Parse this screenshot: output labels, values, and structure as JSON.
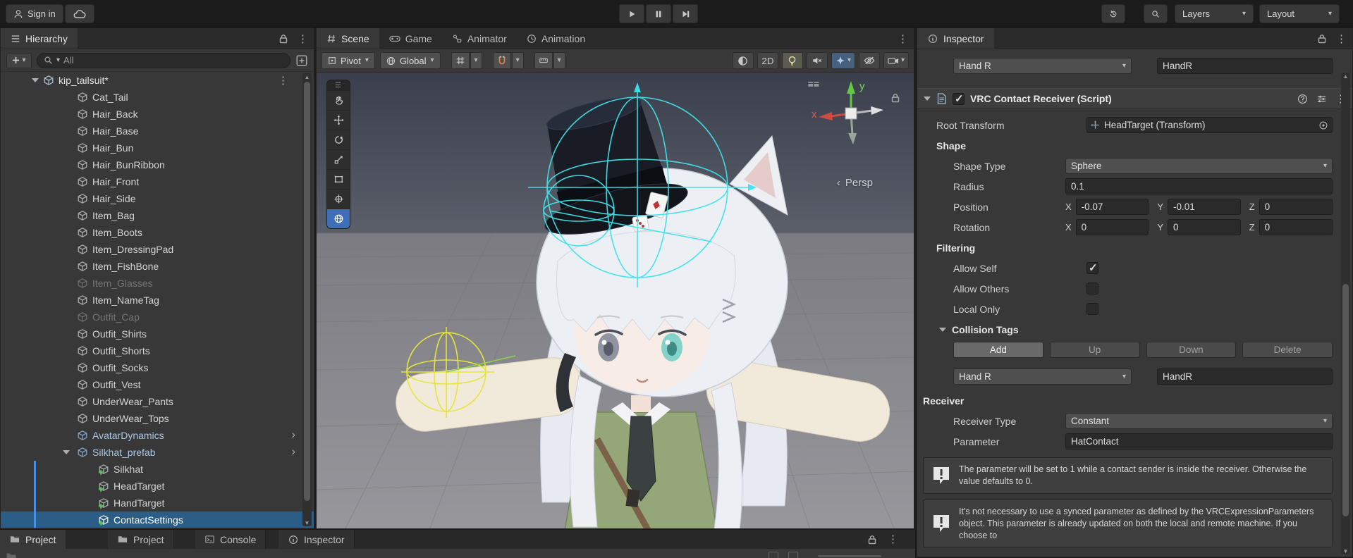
{
  "topbar": {
    "sign_in_label": "Sign in",
    "layers_label": "Layers",
    "layout_label": "Layout"
  },
  "hierarchy": {
    "tab_label": "Hierarchy",
    "search_placeholder": "All",
    "root_label": "kip_tailsuit*",
    "items": [
      {
        "label": "Cat_Tail",
        "state": "normal"
      },
      {
        "label": "Hair_Back",
        "state": "normal"
      },
      {
        "label": "Hair_Base",
        "state": "normal"
      },
      {
        "label": "Hair_Bun",
        "state": "normal"
      },
      {
        "label": "Hair_BunRibbon",
        "state": "normal"
      },
      {
        "label": "Hair_Front",
        "state": "normal"
      },
      {
        "label": "Hair_Side",
        "state": "normal"
      },
      {
        "label": "Item_Bag",
        "state": "normal"
      },
      {
        "label": "Item_Boots",
        "state": "normal"
      },
      {
        "label": "Item_DressingPad",
        "state": "normal"
      },
      {
        "label": "Item_FishBone",
        "state": "normal"
      },
      {
        "label": "Item_Glasses",
        "state": "disabled"
      },
      {
        "label": "Item_NameTag",
        "state": "normal"
      },
      {
        "label": "Outfit_Cap",
        "state": "disabled"
      },
      {
        "label": "Outfit_Shirts",
        "state": "normal"
      },
      {
        "label": "Outfit_Shorts",
        "state": "normal"
      },
      {
        "label": "Outfit_Socks",
        "state": "normal"
      },
      {
        "label": "Outfit_Vest",
        "state": "normal"
      },
      {
        "label": "UnderWear_Pants",
        "state": "normal"
      },
      {
        "label": "UnderWear_Tops",
        "state": "normal"
      },
      {
        "label": "AvatarDynamics",
        "state": "prefab"
      },
      {
        "label": "Silkhat_prefab",
        "state": "prefab-expanded"
      },
      {
        "label": "Silkhat",
        "state": "added-child"
      },
      {
        "label": "HeadTarget",
        "state": "added-child"
      },
      {
        "label": "HandTarget",
        "state": "added-child"
      },
      {
        "label": "ContactSettings",
        "state": "added-child-selected"
      }
    ]
  },
  "scene": {
    "tabs": [
      {
        "label": "Scene"
      },
      {
        "label": "Game"
      },
      {
        "label": "Animator"
      },
      {
        "label": "Animation"
      }
    ],
    "toolbar": {
      "pivot_label": "Pivot",
      "global_label": "Global",
      "mode_2d_label": "2D"
    },
    "viewport": {
      "persp_label": "Persp",
      "axis_x_label": "x",
      "axis_y_label": "y"
    }
  },
  "inspector": {
    "tab_label": "Inspector",
    "target_dropdown_value": "Hand R",
    "target_name_value": "HandR",
    "component_title": "VRC Contact Receiver (Script)",
    "axes": {
      "x": "X",
      "y": "Y",
      "z": "Z"
    },
    "root_transform": {
      "label": "Root Transform",
      "value": "HeadTarget (Transform)"
    },
    "shape": {
      "header": "Shape",
      "shape_type_label": "Shape Type",
      "shape_type_value": "Sphere",
      "radius_label": "Radius",
      "radius_value": "0.1",
      "position_label": "Position",
      "position": {
        "x": "-0.07",
        "y": "-0.01",
        "z": "0"
      },
      "rotation_label": "Rotation",
      "rotation": {
        "x": "0",
        "y": "0",
        "z": "0"
      }
    },
    "filtering": {
      "header": "Filtering",
      "allow_self_label": "Allow Self",
      "allow_self_checked": true,
      "allow_others_label": "Allow Others",
      "allow_others_checked": false,
      "local_only_label": "Local Only",
      "local_only_checked": false
    },
    "collision_tags": {
      "header": "Collision Tags",
      "add_label": "Add",
      "up_label": "Up",
      "down_label": "Down",
      "delete_label": "Delete",
      "tag_dropdown_value": "Hand R",
      "tag_name_value": "HandR"
    },
    "receiver": {
      "header": "Receiver",
      "receiver_type_label": "Receiver Type",
      "receiver_type_value": "Constant",
      "parameter_label": "Parameter",
      "parameter_value": "HatContact",
      "info_primary": "The parameter will be set to 1 while a contact sender is inside the receiver.  Otherwise the value defaults to 0.",
      "info_secondary": "It's not necessary to use a synced parameter as defined by the VRCExpressionParameters object.  This parameter is already updated on both the local and remote machine.  If you choose to"
    }
  },
  "bottombar": {
    "dock_tab_label": "Project",
    "tabs": [
      {
        "label": "Project"
      },
      {
        "label": "Console"
      },
      {
        "label": "Inspector"
      }
    ]
  },
  "colors": {
    "selection_blue": "#2C5D87",
    "prefab_text": "#A9C8E4",
    "gizmo_cyan": "#3FE3EA",
    "gizmo_yellow": "#E4E63B",
    "accent_blue": "#4A90E2"
  }
}
